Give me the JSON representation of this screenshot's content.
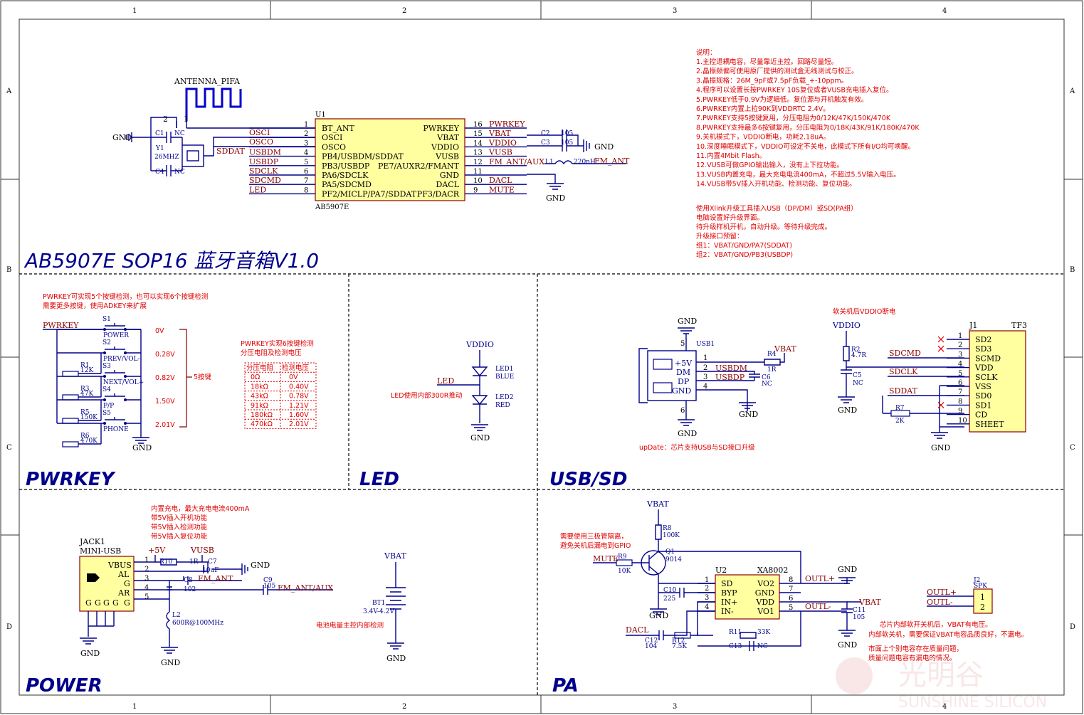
{
  "grid": {
    "cols": [
      "1",
      "2",
      "3",
      "4"
    ],
    "rows": [
      "A",
      "B",
      "C",
      "D"
    ]
  },
  "title": "AB5907E SOP16 蓝牙音箱V1.0",
  "sections": {
    "pwrkey": "PWRKEY",
    "led": "LED",
    "usbsd": "USB/SD",
    "power": "POWER",
    "pa": "PA"
  },
  "u1": {
    "ref": "U1",
    "part": "AB5907E",
    "left_pins": [
      {
        "n": "1",
        "name": "BT_ANT",
        "net": ""
      },
      {
        "n": "2",
        "name": "OSCI",
        "net": "OSCI"
      },
      {
        "n": "3",
        "name": "OSCO",
        "net": "OSCO"
      },
      {
        "n": "4",
        "name": "PB4/USBDM/SDDAT",
        "net": "USBDM"
      },
      {
        "n": "5",
        "name": "PB3/USBDP",
        "net": "USBDP"
      },
      {
        "n": "6",
        "name": "PA6/SDCLK",
        "net": "SDCLK"
      },
      {
        "n": "7",
        "name": "PA5/SDCMD",
        "net": "SDCMD"
      },
      {
        "n": "8",
        "name": "PF2/MICLP/PA7/SDDAT",
        "net": "LED"
      }
    ],
    "right_pins": [
      {
        "n": "16",
        "name": "PWRKEY",
        "net": "PWRKEY"
      },
      {
        "n": "15",
        "name": "VBAT",
        "net": "VBAT"
      },
      {
        "n": "14",
        "name": "VDDIO",
        "net": "VDDIO"
      },
      {
        "n": "13",
        "name": "VUSB",
        "net": "VUSB"
      },
      {
        "n": "12",
        "name": "PE7/AUXR2/FMANT",
        "net": "FM_ANT/AUX"
      },
      {
        "n": "11",
        "name": "GND",
        "net": ""
      },
      {
        "n": "10",
        "name": "DACL",
        "net": "DACL"
      },
      {
        "n": "9",
        "name": "PF3/DACR",
        "net": "MUTE"
      }
    ]
  },
  "crystal": {
    "antenna": "ANTENNA_PIFA",
    "ant_pins": [
      "2",
      "1"
    ],
    "c1": "C1",
    "c4": "C4",
    "nc": "NC",
    "y1": "Y1",
    "freq": "26MHZ",
    "gnd": "GND",
    "sddat": "SDDAT"
  },
  "caps_right": {
    "c2": "C2",
    "c3": "C3",
    "val": "105",
    "l1": "L1",
    "l1v": "220nH",
    "fm": "FM_ANT",
    "gnd": "GND"
  },
  "notes_title": "说明：",
  "notes": [
    "1.主控退耦电容，尽量靠近主控。回路尽量短。",
    "2.晶振频偏可使用原厂提供的测试盒无线测试与校正。",
    "3.晶振规格：26M_9pF或7.5pF负载_+-10ppm。",
    "4.程序可以设置长按PWRKEY 10S复位或者VUSB充电插入复位。",
    "5.PWRKEY低于0.9V为逻辑低。复位源与开机触发有效。",
    "6.PWRKEY内置上拉90K到VDDRTC 2.4V。",
    "7.PWRKEY支持5按键复用，分压电阻为0/12K/47K/150K/470K",
    "8.PWRKEY支持最多6按键复用，分压电阻为0/18K/43K/91K/180K/470K",
    "9.关机模式下，VDDIO断电，功耗2.18uA。",
    "10.深度睡眠模式下，VDDIO可设定不关电，此模式下所有I/O均可唤醒。",
    "11.内置4Mbit Flash。",
    "12.VUSB可做GPIO输出输入，没有上下拉功能。",
    "13.VUSB内置充电，最大充电电流400mA，不超过5.5V输入电压。",
    "14.VUSB带5V插入开机功能、检测功能、复位功能。"
  ],
  "upgrade": [
    "使用Xlink升级工具插入USB（DP/DM）或SD(PA组）",
    "电脑设置好升级界面。",
    "待升级样机开机，自动升级。等待升级完成。",
    "升级接口预留：",
    "组1：VBAT/GND/PA7(SDDAT)",
    "组2：VBAT/GND/PB3(USBDP)"
  ],
  "pwrkey_block": {
    "note1": "PWRKEY可实现5个按键检测，也可以实现6个按键检测",
    "note2": "需要更多按键，使用ADKEY来扩展",
    "net": "PWRKEY",
    "keys": [
      {
        "s": "S1",
        "name": "POWER",
        "r": "",
        "rv": "",
        "v": "0V"
      },
      {
        "s": "S2",
        "name": "PREV/VOL-",
        "r": "R1",
        "rv": "12K",
        "v": "0.28V"
      },
      {
        "s": "S3",
        "name": "NEXT/VOL+",
        "r": "R3",
        "rv": "47K",
        "v": "0.82V"
      },
      {
        "s": "S4",
        "name": "P/P",
        "r": "R5",
        "rv": "150K",
        "v": "1.50V"
      },
      {
        "s": "S5",
        "name": "PHONE",
        "r": "R6",
        "rv": "470K",
        "v": "2.01V"
      }
    ],
    "count": "5按键",
    "gnd": "GND",
    "table_note1": "PWRKEY实现6按键检测",
    "table_note2": "分压电阻及检测电压",
    "table_head": [
      "分压电阻",
      "检测电压"
    ],
    "table_rows": [
      [
        "0Ω",
        "0V"
      ],
      [
        "18kΩ",
        "0.40V"
      ],
      [
        "43kΩ",
        "0.78V"
      ],
      [
        "91kΩ",
        "1.21V"
      ],
      [
        "180kΩ",
        "1.60V"
      ],
      [
        "470kΩ",
        "2.01V"
      ]
    ]
  },
  "led_block": {
    "vddio": "VDDIO",
    "led": "LED",
    "led1": "LED1",
    "blue": "BLUE",
    "led2": "LED2",
    "red": "RED",
    "note": "LED使用内部300R推动",
    "gnd": "GND"
  },
  "usb_block": {
    "gnd": "GND",
    "usb1": "USB1",
    "pins": [
      "+5V",
      "DM",
      "DP",
      "GND"
    ],
    "nums": [
      "1",
      "2",
      "3",
      "4",
      "5",
      "6"
    ],
    "vbat": "VBAT",
    "r4": "R4",
    "r4v": "1R",
    "c6": "C6",
    "c6v": "NC",
    "usbdm": "USBDM",
    "usbdp": "USBDP",
    "note": "upDate：芯片支持USB与SD接口升级"
  },
  "tf_block": {
    "note": "软关机后VDDIO断电",
    "vddio": "VDDIO",
    "r2": "R2",
    "r2v": "4.7R",
    "c5": "C5",
    "c5v": "NC",
    "r7": "R7",
    "r7v": "2K",
    "j1": "J1",
    "tf3": "TF3",
    "gnd": "GND",
    "nets": [
      "SDCMD",
      "SDCLK",
      "SDDAT"
    ],
    "pins": [
      {
        "n": "1",
        "name": "SD2"
      },
      {
        "n": "2",
        "name": "SD3"
      },
      {
        "n": "3",
        "name": "SCMD"
      },
      {
        "n": "4",
        "name": "VDD"
      },
      {
        "n": "5",
        "name": "SCLK"
      },
      {
        "n": "6",
        "name": "VSS"
      },
      {
        "n": "7",
        "name": "SD0"
      },
      {
        "n": "8",
        "name": "SD1"
      },
      {
        "n": "9",
        "name": "CD"
      },
      {
        "n": "10",
        "name": "SHEET"
      }
    ]
  },
  "power_block": {
    "jack": "JACK1",
    "mini": "MINI-USB",
    "pins": [
      "VBUS",
      "AL",
      "G",
      "AR",
      "G"
    ],
    "bottom": [
      "G",
      "G",
      "G",
      "G"
    ],
    "p5v": "+5V",
    "vusb": "VUSB",
    "r10": "R10",
    "r10v": "1R",
    "c7": "C7",
    "c7v": "10uF",
    "c8": "C8",
    "c8v": "102",
    "fm": "FM_ANT",
    "c9": "C9",
    "c9v": "105",
    "fmaux": "FM_ANT/AUX",
    "l2": "L2",
    "l2v": "600R@100MHz",
    "gnd": "GND",
    "notes": [
      "内置充电，最大充电电流400mA",
      "带5V插入开机功能",
      "带5V插入检测功能",
      "带5V插入复位功能"
    ],
    "vbat": "VBAT",
    "bt1": "BT1",
    "bt1v": "3.4V-4.2V",
    "batnote": "电池电量主控内部检测"
  },
  "pa_block": {
    "vbat": "VBAT",
    "r8": "R8",
    "r8v": "100K",
    "q1": "Q1",
    "q1v": "9014",
    "r9": "R9",
    "r9v": "10K",
    "mute": "MUTE",
    "note1": "需要使用三极管隔离，",
    "note2": "避免关机后漏电到GPIO",
    "u2": "U2",
    "u2part": "XA8002",
    "left": [
      "SD",
      "BYP",
      "IN+",
      "IN-"
    ],
    "right": [
      "VO2",
      "GND",
      "VDD",
      "VO1"
    ],
    "outlp": "OUTL+",
    "outlm": "OUTL-",
    "c10": "C10",
    "c10v": "225",
    "c11": "C11",
    "c11v": "105",
    "c12": "C12",
    "c12v": "104",
    "r12": "R12",
    "r12v": "7.5K",
    "r11": "R11",
    "r11v": "33K",
    "c13": "C13",
    "c13v": "NC",
    "dacl": "DACL",
    "gnd": "GND",
    "spk": "J2",
    "spkv": "SPK",
    "spk_pins": [
      "1",
      "2"
    ],
    "note3": "芯片内部软开关机后，VBAT有电压。",
    "note4": "内部软关机，需要保证VBAT电容品质良好，不漏电。",
    "note5": "市面上个别电容存在质量问题，",
    "note6": "质量问题电容有漏电的情况。"
  },
  "watermark": {
    "cn": "光明谷",
    "en": "SUNSHINE SILICON"
  }
}
